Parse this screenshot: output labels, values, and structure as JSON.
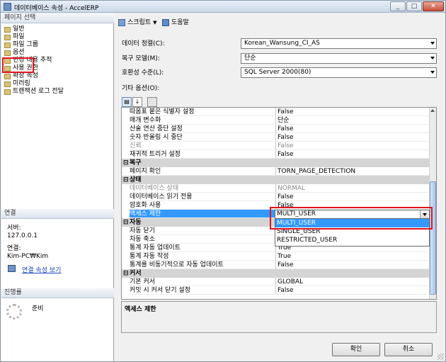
{
  "window": {
    "title": "데이터베이스 속성 - AccelERP"
  },
  "left_panel": {
    "select_page_header": "페이지 선택",
    "pages": [
      "일반",
      "파일",
      "파일 그룹",
      "옵션",
      "변경 내용 추적",
      "사용 권한",
      "확장 속성",
      "미러링",
      "트랜잭션 로그 전달"
    ],
    "connection_header": "연결",
    "server_label": "서버:",
    "server_value": "127.0.0.1",
    "connection_label": "연결:",
    "connection_value": "Kim-PC₩Kim",
    "view_connection_link": "연결 속성 보기",
    "progress_header": "진행률",
    "progress_status": "준비"
  },
  "toolbar": {
    "script_label": "스크립트",
    "help_label": "도움말"
  },
  "form": {
    "collation_label": "데이터 정렬(C):",
    "collation_value": "Korean_Wansung_CI_AS",
    "recovery_label": "복구 모델(M):",
    "recovery_value": "단순",
    "compat_label": "호환성 수준(L):",
    "compat_value": "SQL Server 2000(80)",
    "other_options_label": "기타 옵션(O):"
  },
  "grid_rows": [
    {
      "name": "따옴표 붙은 식별자 설정",
      "value": "False"
    },
    {
      "name": "매개 변수화",
      "value": "단순"
    },
    {
      "name": "산술 연산 중단 설정",
      "value": "False"
    },
    {
      "name": "숫자 반올림 시 중단",
      "value": "False"
    },
    {
      "name": "신뢰",
      "value": "False"
    },
    {
      "name": "재귀적 트리거 설정",
      "value": "False"
    },
    {
      "name": "복구",
      "value": ""
    },
    {
      "name": "페이지 확인",
      "value": "TORN_PAGE_DETECTION"
    },
    {
      "name": "상태",
      "value": ""
    },
    {
      "name": "데이터베이스 상태",
      "value": "NORMAL"
    },
    {
      "name": "데이터베이스 읽기 전용",
      "value": "False"
    },
    {
      "name": "암호화 사용",
      "value": "False"
    },
    {
      "name": "액세스 제한",
      "value": ""
    },
    {
      "name": "자동",
      "value": ""
    },
    {
      "name": "자동 닫기",
      "value": ""
    },
    {
      "name": "자동 축소",
      "value": ""
    },
    {
      "name": "통계 자동 업데이트",
      "value": "True"
    },
    {
      "name": "통계 자동 작성",
      "value": "True"
    },
    {
      "name": "통계를 비동기적으로 자동 업데이트",
      "value": "False"
    },
    {
      "name": "커서",
      "value": ""
    },
    {
      "name": "기본 커서",
      "value": "GLOBAL"
    },
    {
      "name": "커밋 시 커서 닫기 설정",
      "value": "False"
    }
  ],
  "dropdown": {
    "current": "MULTI_USER",
    "options": [
      "MULTI_USER",
      "SINGLE_USER",
      "RESTRICTED_USER"
    ]
  },
  "description_title": "액세스 제한",
  "buttons": {
    "ok": "확인",
    "cancel": "취소"
  },
  "colors": {
    "highlight": "#e0141f",
    "selection": "#3399ff"
  }
}
